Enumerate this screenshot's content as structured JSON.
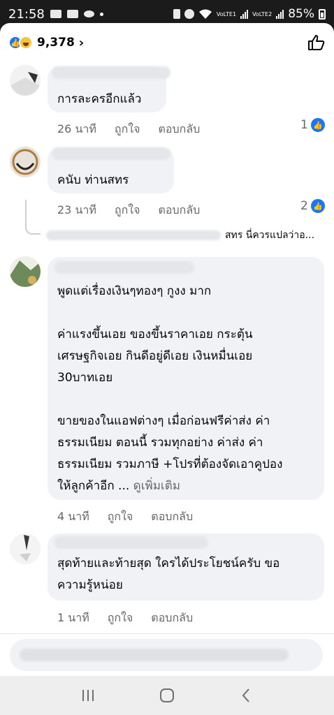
{
  "status_bar": {
    "time": "21:58",
    "battery": "85%",
    "sim1": "VoLTE1",
    "sim2": "VoLTE2"
  },
  "reactions": {
    "count": "9,378",
    "icons": [
      "like-icon",
      "haha-icon"
    ]
  },
  "comments": [
    {
      "text": "การละครอีกแล้ว",
      "time": "26 นาที",
      "like_label": "ถูกใจ",
      "reply_label": "ตอบกลับ",
      "likes": "1"
    },
    {
      "text": "คนับ ท่านสทร",
      "time": "23 นาที",
      "like_label": "ถูกใจ",
      "reply_label": "ตอบกลับ",
      "likes": "2",
      "reply_preview": "สทร นี่ควรแปลว่าอ..."
    },
    {
      "text": "พูดแต่เรื่องเงินๆทองๆ กูงง มาก\n\nค่าแรงขึ้นเอย ของขึ้นราคาเอย กระตุ้น\nเศรษฐกิจเอย กินดีอยู่ดีเอย เงินหมื่นเอย\n30บาทเอย\n\nขายของในแอฟต่างๆ เมื่อก่อนฟรีค่าส่ง ค่า\nธรรมเนียม ตอนนี้ รวมทุกอย่าง ค่าส่ง ค่า\nธรรมเนียม รวมภาษี +โปรที่ต้องจัดเอาคูปอง\nให้ลูกค้าอีก ...",
      "see_more": "ดูเพิ่มเติม",
      "time": "4 นาที",
      "like_label": "ถูกใจ",
      "reply_label": "ตอบกลับ"
    },
    {
      "text": "สุดท้ายและท้ายสุด ใครได้ประโยชน์ครับ ขอ\nความรู้หน่อย",
      "time": "1 นาที",
      "like_label": "ถูกใจ",
      "reply_label": "ตอบกลับ"
    }
  ],
  "colors": {
    "accent": "#1877f2",
    "bubble": "#f0f2f5",
    "meta_text": "#65676b"
  },
  "nav": {
    "icons": [
      "recent-apps-icon",
      "home-icon",
      "back-icon"
    ]
  }
}
